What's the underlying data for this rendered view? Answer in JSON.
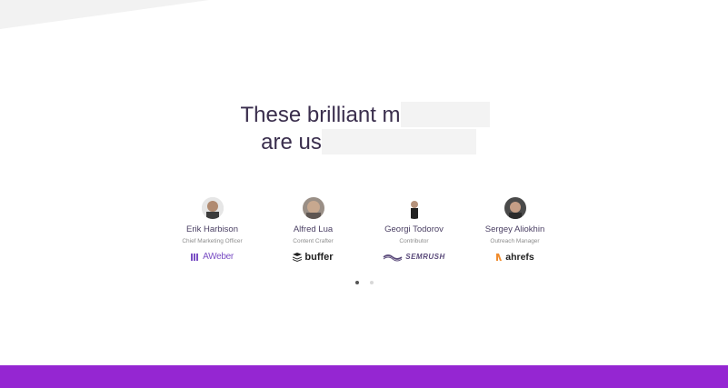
{
  "headline": {
    "line1": "These brilliant m",
    "line2": "are us"
  },
  "people": [
    {
      "name": "Erik Harbison",
      "role": "Chief Marketing Officer",
      "company": "AWeber",
      "logo_icon": "aweber-logo-icon"
    },
    {
      "name": "Alfred Lua",
      "role": "Content Crafter",
      "company": "buffer",
      "logo_icon": "buffer-logo-icon"
    },
    {
      "name": "Georgi Todorov",
      "role": "Contributor",
      "company": "SEMRUSH",
      "logo_icon": "semrush-logo-icon"
    },
    {
      "name": "Sergey Aliokhin",
      "role": "Outreach Manager",
      "company": "ahrefs",
      "logo_icon": "ahrefs-logo-icon"
    }
  ],
  "carousel": {
    "page_count": 2,
    "active_index": 0
  },
  "colors": {
    "footer": "#9526d2",
    "headline": "#3a2e4d",
    "name": "#4a3f63"
  }
}
